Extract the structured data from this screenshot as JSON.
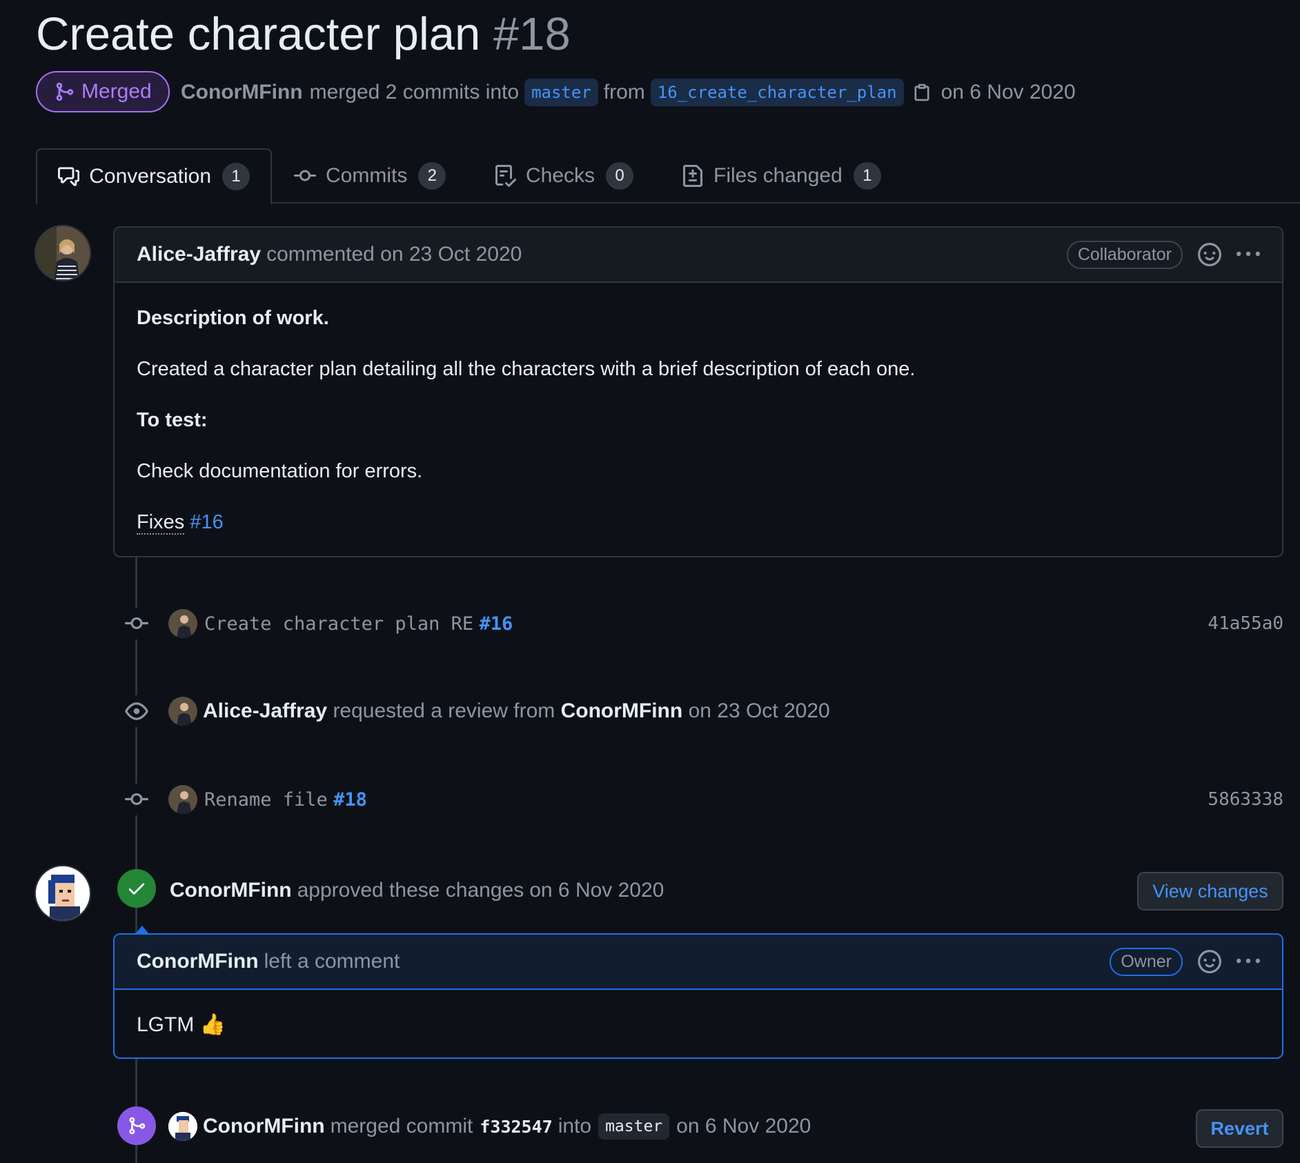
{
  "pr": {
    "title": "Create character plan",
    "number": "#18",
    "status": "Merged",
    "author": "ConorMFinn",
    "merge_text": "merged 2 commits into",
    "base_branch": "master",
    "from_text": "from",
    "head_branch": "16_create_character_plan",
    "date_text": "on 6 Nov 2020"
  },
  "tabs": [
    {
      "label": "Conversation",
      "count": "1"
    },
    {
      "label": "Commits",
      "count": "2"
    },
    {
      "label": "Checks",
      "count": "0"
    },
    {
      "label": "Files changed",
      "count": "1"
    }
  ],
  "comment1": {
    "author": "Alice-Jaffray",
    "action": "commented on 23 Oct 2020",
    "role": "Collaborator",
    "heading1": "Description of work.",
    "para1": "Created a character plan detailing all the characters with a brief description of each one.",
    "heading2": "To test:",
    "para2": "Check documentation for errors.",
    "fixes_label": "Fixes",
    "fixes_ref": "#16"
  },
  "timeline": {
    "commit1": {
      "message": "Create character plan RE",
      "ref": "#16",
      "sha": "41a55a0"
    },
    "review_request": {
      "actor": "Alice-Jaffray",
      "text": "requested a review from",
      "reviewer": "ConorMFinn",
      "date": "on 23 Oct 2020"
    },
    "commit2": {
      "message": "Rename file",
      "ref": "#18",
      "sha": "5863338"
    },
    "approval": {
      "actor": "ConorMFinn",
      "text": "approved these changes",
      "date": "on 6 Nov 2020",
      "button": "View changes"
    },
    "merge": {
      "actor": "ConorMFinn",
      "text": "merged commit",
      "sha": "f332547",
      "into": "into",
      "branch": "master",
      "date": "on 6 Nov 2020",
      "button": "Revert"
    }
  },
  "comment2": {
    "author": "ConorMFinn",
    "action": "left a comment",
    "role": "Owner",
    "body": "LGTM 👍"
  },
  "colors": {
    "background": "#0d1117",
    "merged_purple": "#8957e5",
    "approved_green": "#238636",
    "link_blue": "#4493f8"
  },
  "icons": [
    "git-merge-icon",
    "comment-discussion-icon",
    "git-commit-icon",
    "checklist-icon",
    "file-diff-icon",
    "copy-icon",
    "smiley-icon",
    "kebab-horizontal-icon",
    "eye-icon",
    "check-icon"
  ]
}
